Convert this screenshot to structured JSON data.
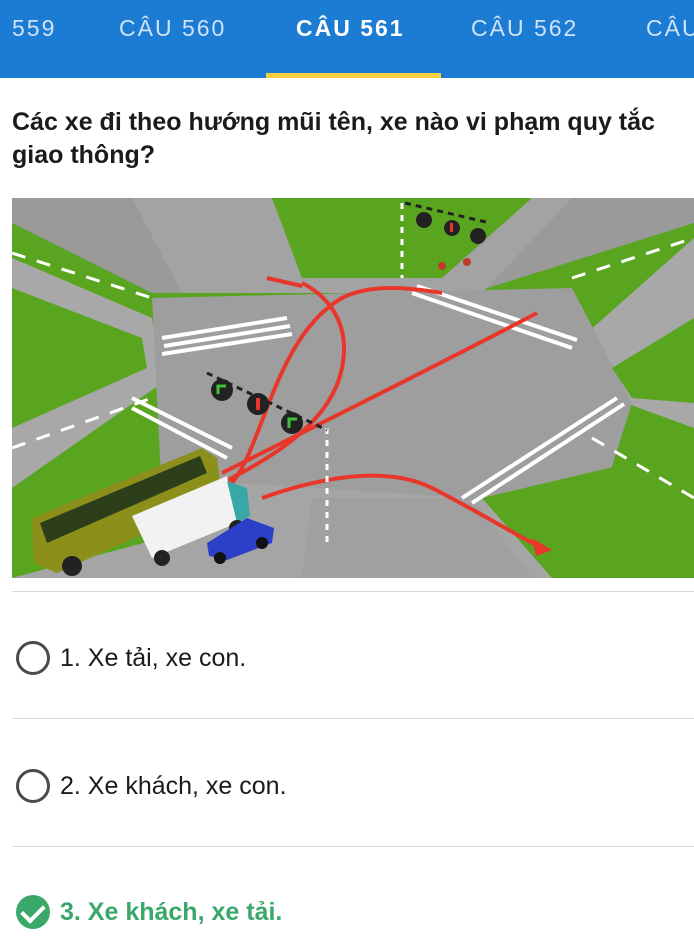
{
  "tabs": [
    {
      "label": "559"
    },
    {
      "label": "CÂU 560"
    },
    {
      "label": "CÂU 561"
    },
    {
      "label": "CÂU 562"
    },
    {
      "label": "CÂU"
    }
  ],
  "active_tab": "CÂU 561",
  "question": {
    "text": "Các xe đi theo hướng mũi tên, xe nào vi phạm quy tắc giao thông?"
  },
  "answers": [
    {
      "label": "1. Xe tải, xe con.",
      "selected": false,
      "correct": false
    },
    {
      "label": "2. Xe khách, xe con.",
      "selected": false,
      "correct": false
    },
    {
      "label": "3. Xe khách, xe tải.",
      "selected": true,
      "correct": true
    }
  ],
  "colors": {
    "tab_bar": "#1c7bd3",
    "tab_indicator": "#f4d03f",
    "correct": "#3aa86a"
  },
  "icons": {
    "correct_mark": "check-circle-icon",
    "unselected_mark": "radio-empty-icon"
  }
}
